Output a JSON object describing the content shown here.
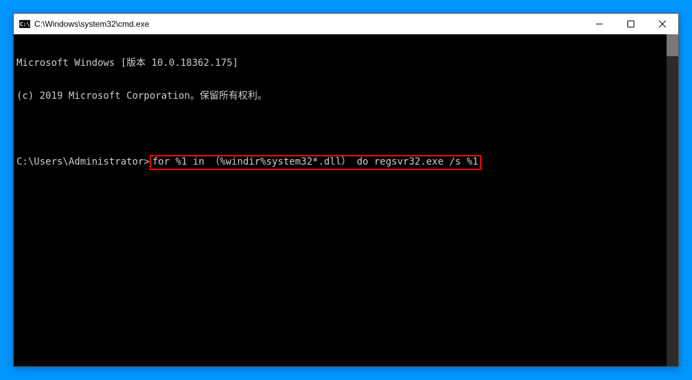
{
  "titlebar": {
    "icon_text": "C:\\",
    "title": "C:\\Windows\\system32\\cmd.exe"
  },
  "console": {
    "line1": "Microsoft Windows [版本 10.0.18362.175]",
    "line2": "(c) 2019 Microsoft Corporation。保留所有权利。",
    "prompt": "C:\\Users\\Administrator>",
    "command": "for %1 in （%windir%system32*.dll） do regsvr32.exe /s %1"
  }
}
